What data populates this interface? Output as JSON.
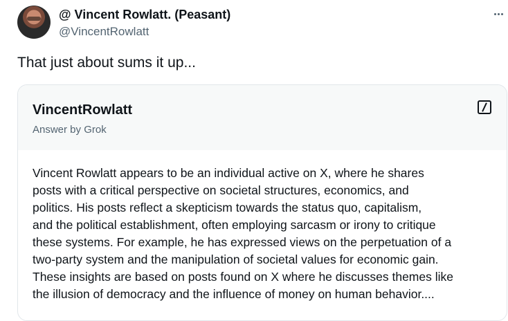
{
  "post": {
    "display_name": "@ Vincent Rowlatt. (Peasant)",
    "handle": "@VincentRowlatt",
    "avatar_icon": "profile-photo",
    "more_icon": "more-horizontal-icon",
    "text": "That just about sums it up..."
  },
  "grok_card": {
    "title": "VincentRowlatt",
    "subtitle": "Answer by Grok",
    "grok_icon": "grok-logo-icon",
    "body_lines": [
      "Vincent Rowlatt appears to be an individual active on X, where he shares",
      "posts with a critical perspective on societal structures, economics, and",
      "politics. His posts reflect a skepticism towards the status quo, capitalism,",
      "and the political establishment, often employing sarcasm or irony to critique",
      "these systems. For example, he has expressed views on the perpetuation of a",
      "two-party system and the manipulation of societal values for economic gain.",
      "These insights are based on posts found on X where he discusses themes like",
      "the illusion of democracy and the influence of money on human behavior...."
    ]
  },
  "colors": {
    "text_primary": "#0f1419",
    "text_secondary": "#536471",
    "card_header_bg": "#f7f9f9",
    "border": "#e1e6ea"
  }
}
